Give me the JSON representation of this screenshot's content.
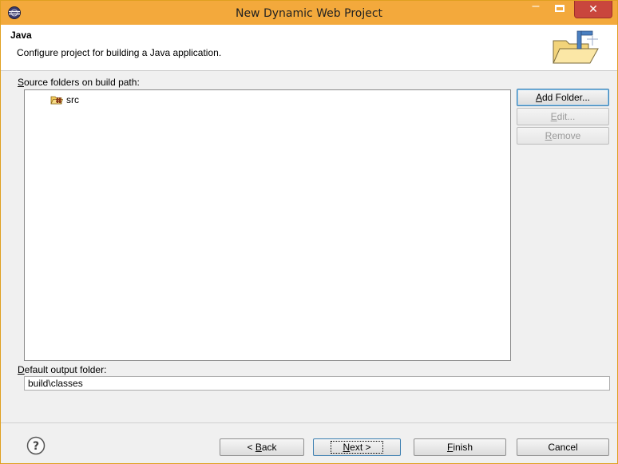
{
  "window": {
    "title": "New Dynamic Web Project",
    "minimize_glyph": "–",
    "close_glyph": "✕"
  },
  "header": {
    "title": "Java",
    "description": "Configure project for building a Java application."
  },
  "source_folders": {
    "label_underline": "S",
    "label_rest": "ource folders on build path:",
    "items": [
      {
        "name": "src",
        "icon": "source-folder-icon"
      }
    ]
  },
  "side_buttons": {
    "add_folder_u": "A",
    "add_folder_rest": "dd Folder...",
    "edit_u": "E",
    "edit_rest": "dit...",
    "remove_u": "R",
    "remove_rest": "emove"
  },
  "output": {
    "label_underline": "D",
    "label_rest": "efault output folder:",
    "value": "build\\classes"
  },
  "footer": {
    "back_prefix": "< ",
    "back_u": "B",
    "back_rest": "ack",
    "next_u": "N",
    "next_rest": "ext >",
    "finish_u": "F",
    "finish_rest": "inish",
    "cancel": "Cancel"
  },
  "colors": {
    "titlebar": "#f3a93c",
    "close_button": "#c9463d",
    "focus_border": "#3c7fb1"
  }
}
